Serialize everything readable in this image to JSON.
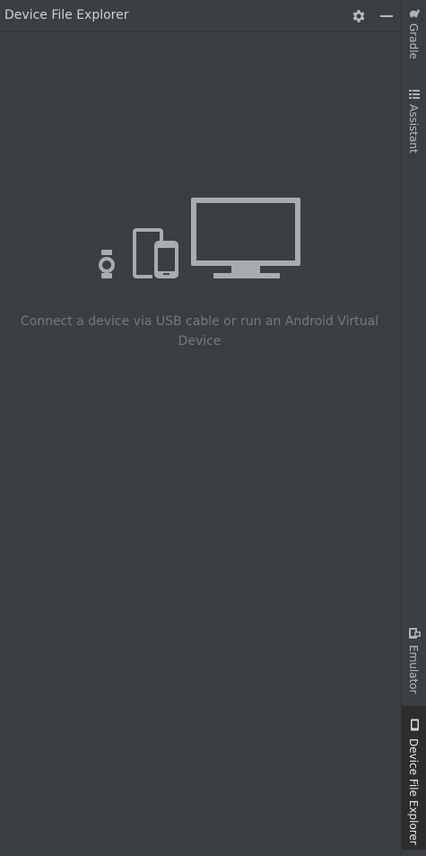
{
  "panel": {
    "title": "Device File Explorer",
    "icons": {
      "settings": "gear-icon",
      "minimize": "minimize-icon"
    }
  },
  "empty_state": {
    "message": "Connect a device via USB cable or run an Android Virtual Device",
    "illustration_icons": [
      "watch-icon",
      "tablet-icon",
      "phone-icon",
      "tv-icon"
    ]
  },
  "right_toolbar": {
    "top": [
      {
        "label": "Gradle",
        "icon": "gradle-icon"
      },
      {
        "label": "Assistant",
        "icon": "assistant-icon"
      }
    ],
    "bottom": [
      {
        "label": "Emulator",
        "icon": "emulator-icon"
      },
      {
        "label": "Device File Explorer",
        "icon": "device-file-explorer-icon",
        "active": true
      }
    ]
  },
  "colors": {
    "background": "#3c3f41",
    "text": "#d0d0d0",
    "muted_text": "#787878",
    "icon": "#a9abad",
    "active_stripe": "#2b2d2f"
  }
}
